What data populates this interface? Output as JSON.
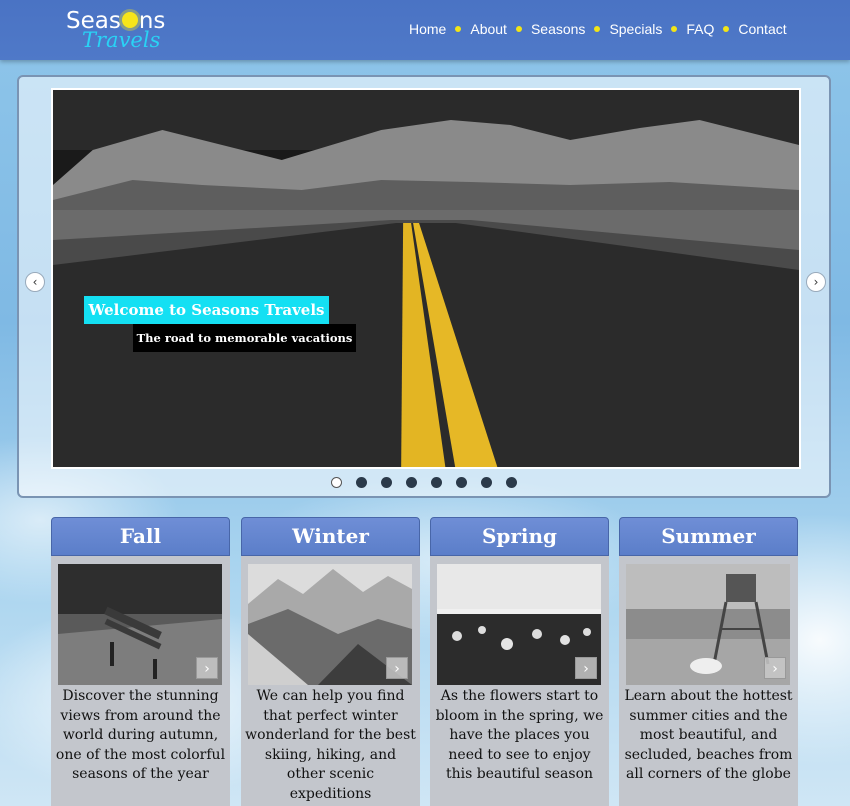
{
  "logo": {
    "top": "Seas",
    "top_end": "ns",
    "bottom": "Travels"
  },
  "nav": [
    {
      "label": "Home"
    },
    {
      "label": "About"
    },
    {
      "label": "Seasons"
    },
    {
      "label": "Specials"
    },
    {
      "label": "FAQ"
    },
    {
      "label": "Contact"
    }
  ],
  "slider": {
    "caption_title": "Welcome to Seasons Travels",
    "caption_subtitle": "The road to memorable vacations",
    "prev_symbol": "‹",
    "next_symbol": "›",
    "active_index": 0,
    "slide_count": 8
  },
  "cards": [
    {
      "title": "Fall",
      "text": "Discover the stunning views from around the world during autumn, one of the most colorful seasons of the year",
      "more": "›"
    },
    {
      "title": "Winter",
      "text": "We can help you find that perfect winter wonderland for the best skiing, hiking, and other scenic expeditions",
      "more": "›"
    },
    {
      "title": "Spring",
      "text": "As the flowers start to bloom in the spring, we have the places you need to see to enjoy this beautiful season",
      "more": "›"
    },
    {
      "title": "Summer",
      "text": "Learn about the hottest summer cities and the most beautiful, and secluded, beaches from all corners of the globe",
      "more": "›"
    }
  ],
  "colors": {
    "header": "#4f79c8",
    "accent": "#f2e516",
    "caption": "#14e0f3"
  }
}
